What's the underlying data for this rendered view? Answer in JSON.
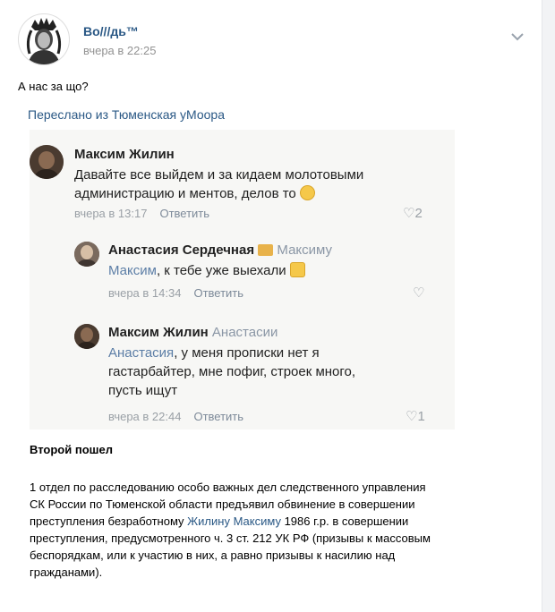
{
  "post": {
    "author": "Во///дь™",
    "time": "вчера в 22:25",
    "text": "А нас за що?",
    "forwarded_from": "Переслано из Тюменская уМоора"
  },
  "comments": [
    {
      "name": "Максим Жилин",
      "reply_to": "",
      "mention": "",
      "text_l1": "Давайте все выйдем и за кидаем молотовыми",
      "text_l2": "администрацию и ментов, делов то",
      "time": "вчера в 13:17",
      "reply_label": "Ответить",
      "likes": "2"
    },
    {
      "name": "Анастасия Сердечная",
      "reply_to": "Максиму",
      "mention": "Максим",
      "text_l1": ", к тебе уже выехали",
      "time": "вчера в 14:34",
      "reply_label": "Ответить",
      "likes": ""
    },
    {
      "name": "Максим Жилин",
      "reply_to": "Анастасии",
      "mention": "Анастасия",
      "text_l1": ", у меня прописки нет я",
      "text_l2": "гастарбайтер, мне пофиг, строек много,",
      "text_l3": "пусть ищут",
      "time": "вчера в 22:44",
      "reply_label": "Ответить",
      "likes": "1"
    }
  ],
  "section_title": "Второй пошел",
  "body": {
    "p1": "1 отдел по расследованию особо важных дел следственного управления СК России по Тюменской области предъявил обвинение в совершении преступления безработному ",
    "link": "Жилину Максиму",
    "p2": " 1986 г.р. в совершении преступления, предусмотренного ч. 3 ст. 212 УК РФ (призывы к массовым беспорядкам, или к участию в них, а равно призывы к насилию над гражданами)."
  },
  "colors": {
    "link": "#2a5885",
    "meta": "#939393",
    "screenshot_bg": "#f7f7f5"
  }
}
